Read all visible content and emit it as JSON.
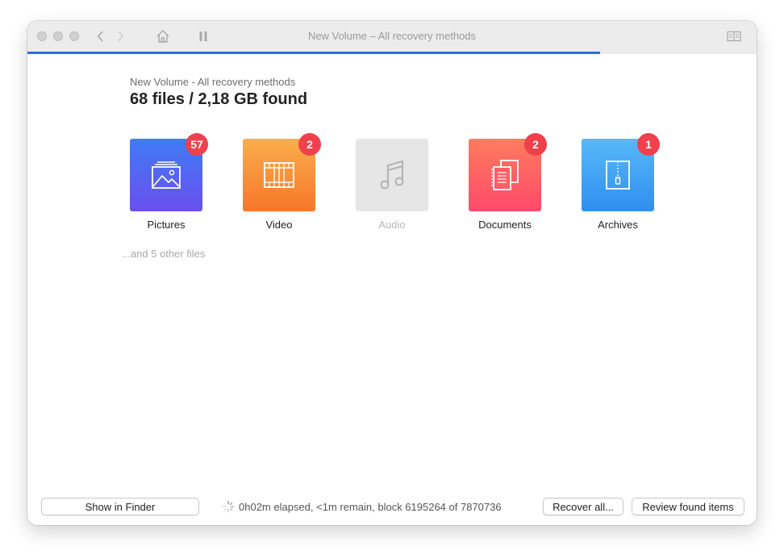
{
  "window": {
    "title": "New Volume – All recovery methods",
    "progress_percent": 78.5
  },
  "header": {
    "subtitle": "New Volume - All recovery methods",
    "headline": "68 files / 2,18 GB found"
  },
  "categories": [
    {
      "label": "Pictures",
      "badge": "57",
      "icon": "picture-icon",
      "color_top": "#3f7cf2",
      "color_bottom": "#6a4ff0",
      "enabled": true
    },
    {
      "label": "Video",
      "badge": "2",
      "icon": "film-icon",
      "color_top": "#fbae4c",
      "color_bottom": "#f6772a",
      "enabled": true
    },
    {
      "label": "Audio",
      "badge": "",
      "icon": "music-note-icon",
      "color_top": "#e6e6e6",
      "color_bottom": "#e6e6e6",
      "enabled": false
    },
    {
      "label": "Documents",
      "badge": "2",
      "icon": "documents-icon",
      "color_top": "#ff7b5e",
      "color_bottom": "#ff4a6a",
      "enabled": true
    },
    {
      "label": "Archives",
      "badge": "1",
      "icon": "zip-archive-icon",
      "color_top": "#58b8f8",
      "color_bottom": "#2f8ff0",
      "enabled": true
    }
  ],
  "other_files": "...and 5 other files",
  "footer": {
    "show_in_finder": "Show in Finder",
    "status": "0h02m elapsed, <1m remain, block 6195264 of 7870736",
    "recover_all": "Recover all...",
    "review": "Review found items"
  }
}
